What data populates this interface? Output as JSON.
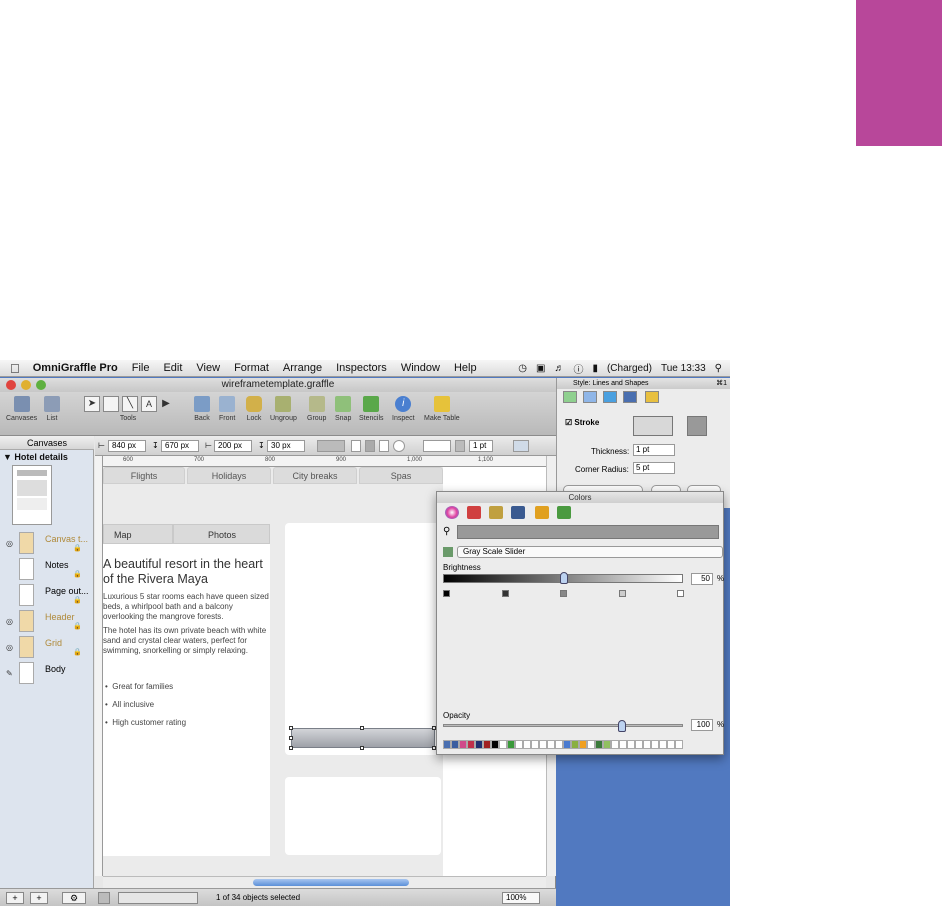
{
  "menubar": {
    "app": "OmniGraffle Pro",
    "items": [
      "File",
      "Edit",
      "View",
      "Format",
      "Arrange",
      "Inspectors",
      "Window",
      "Help"
    ],
    "battery": "(Charged)",
    "clock": "Tue 13:33"
  },
  "window": {
    "title": "wireframetemplate.graffle"
  },
  "toolbar": {
    "canvases": "Canvases",
    "list": "List",
    "tools": "Tools",
    "back": "Back",
    "front": "Front",
    "lock": "Lock",
    "ungroup": "Ungroup",
    "group": "Group",
    "snap": "Snap",
    "stencils": "Stencils",
    "inspect": "Inspect",
    "make_table": "Make Table"
  },
  "sidebar": {
    "header": "Canvases",
    "canvas_title": "Hotel details",
    "layers": [
      {
        "name": "Canvas t...",
        "color": "#f0d9a8",
        "highlight": true
      },
      {
        "name": "Notes",
        "color": "#ffffff",
        "highlight": false
      },
      {
        "name": "Page out...",
        "color": "#ffffff",
        "highlight": false
      },
      {
        "name": "Header",
        "color": "#f0d9a8",
        "highlight": true
      },
      {
        "name": "Grid",
        "color": "#f0d9a8",
        "highlight": true
      },
      {
        "name": "Body",
        "color": "#ffffff",
        "highlight": false
      }
    ]
  },
  "canvas_bar": {
    "width": "840 px",
    "height": "670 px",
    "x": "200 px",
    "y": "30 px",
    "stroke": "1 pt"
  },
  "ruler": {
    "labels": [
      "600",
      "700",
      "800",
      "900",
      "1,000",
      "1,100"
    ]
  },
  "wireframe": {
    "tabs": [
      "Flights",
      "Holidays",
      "City breaks",
      "Spas"
    ],
    "subtabs": [
      "Map",
      "Photos"
    ],
    "heading": "A beautiful resort in the heart of the Rivera Maya",
    "para1": "Luxurious 5 star rooms each have queen sized beds, a whirlpool bath and a balcony overlooking the mangrove forests.",
    "para2": "The hotel has its own private beach with white sand and crystal clear waters, perfect for swimming, snorkelling or simply relaxing.",
    "bullets": [
      "Great for families",
      "All inclusive",
      "High customer rating"
    ]
  },
  "statusbar": {
    "selection": "1 of 34 objects selected",
    "zoom": "100%"
  },
  "inspector": {
    "title": "Style: Lines and Shapes",
    "shortcut": "⌘1",
    "stroke_label": "Stroke",
    "thickness_label": "Thickness:",
    "thickness_value": "1 pt",
    "radius_label": "Corner Radius:",
    "radius_value": "5 pt"
  },
  "colors_panel": {
    "title": "Colors",
    "mode": "Gray Scale Slider",
    "brightness_label": "Brightness",
    "brightness_value": "50",
    "percent": "%",
    "opacity_label": "Opacity",
    "opacity_value": "100",
    "brightness_level": 0.5,
    "opacity_level": 1.0,
    "swatches": [
      "#4a6fb0",
      "#3a5ea0",
      "#d04a8a",
      "#c0304a",
      "#203070",
      "#a02020",
      "#000000",
      "#ffffff",
      "#3a9a3a",
      "#ffffff",
      "#ffffff",
      "#ffffff",
      "#ffffff",
      "#ffffff",
      "#ffffff",
      "#4a7bd0",
      "#8ab040",
      "#f0a020",
      "#ffffff",
      "#3a7a3a",
      "#90c060",
      "#ffffff",
      "#ffffff",
      "#ffffff",
      "#ffffff",
      "#ffffff",
      "#ffffff",
      "#ffffff",
      "#ffffff",
      "#ffffff"
    ]
  },
  "colors": {
    "accent": "#b8479a",
    "desktop": "#5179c0"
  }
}
